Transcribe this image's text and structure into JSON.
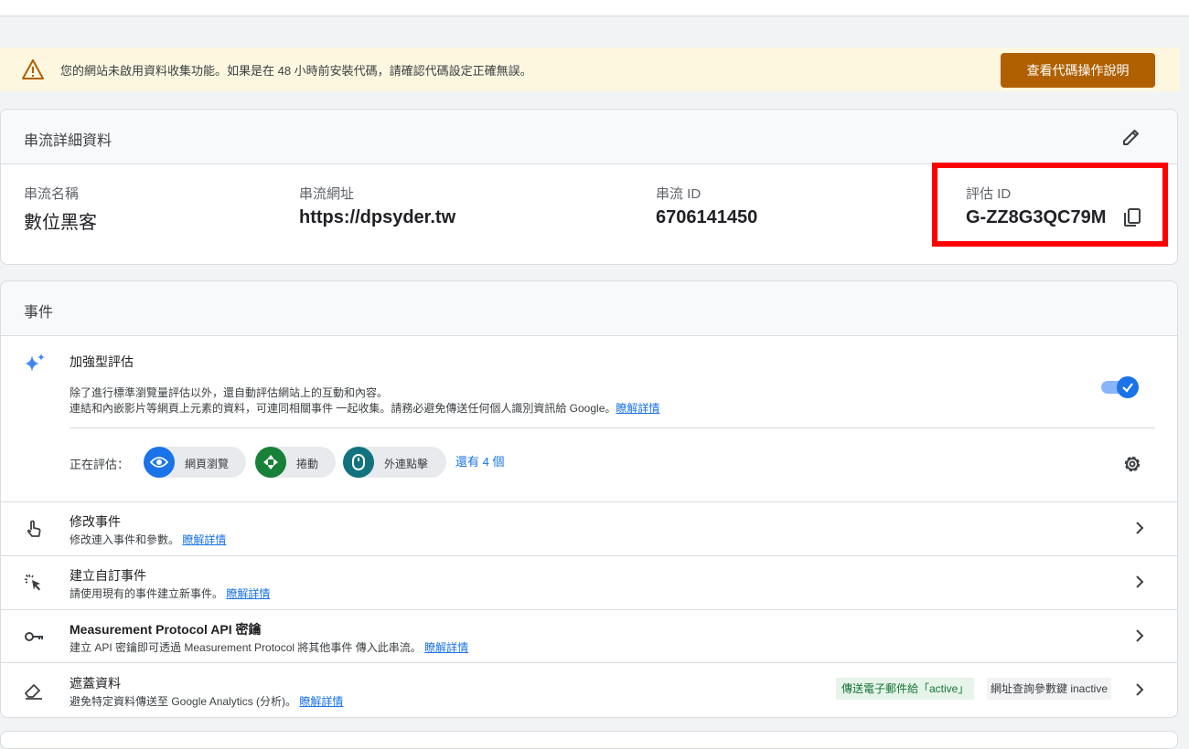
{
  "banner": {
    "message": "您的網站未啟用資料收集功能。如果是在 48 小時前安裝代碼，請確認代碼設定正確無誤。",
    "button_label": "查看代碼操作說明",
    "icon": "warning-icon",
    "color": "#b06000"
  },
  "stream_details": {
    "title": "串流詳細資料",
    "fields": [
      {
        "label": "串流名稱",
        "value": "數位黑客"
      },
      {
        "label": "串流網址",
        "value": "https://dpsyder.tw"
      },
      {
        "label": "串流 ID",
        "value": "6706141450"
      },
      {
        "label": "評估 ID",
        "value": "G-ZZ8G3QC79M"
      }
    ]
  },
  "events": {
    "title": "事件",
    "enhanced": {
      "title": "加強型評估",
      "desc_line1": "除了進行標準瀏覽量評估以外，還自動評估網站上的互動和內容。",
      "desc_line2": "連結和內嵌影片等網頁上元素的資料，可連同相關事件 一起收集。請務必避免傳送任何個人識別資訊給 Google。",
      "learn_more": "瞭解詳情",
      "toggle_on": true,
      "measuring_label": "正在評估：",
      "chips": [
        {
          "label": "網頁瀏覽",
          "icon": "eye-icon",
          "color": "#1a73e8"
        },
        {
          "label": "捲動",
          "icon": "scroll-arrows-icon",
          "color": "#188038"
        },
        {
          "label": "外連點擊",
          "icon": "mouse-icon",
          "color": "#12737e"
        }
      ],
      "more_label": "還有 4 個"
    },
    "rows": [
      {
        "title": "修改事件",
        "desc": "修改連入事件和參數。",
        "learn_more": "瞭解詳情",
        "icon": "touch-icon"
      },
      {
        "title": "建立自訂事件",
        "desc": "請使用現有的事件建立新事件。",
        "learn_more": "瞭解詳情",
        "icon": "click-icon"
      },
      {
        "title": "Measurement Protocol API 密鑰",
        "desc": "建立 API 密鑰即可透過 Measurement Protocol 將其他事件 傳入此串流。",
        "learn_more": "瞭解詳情",
        "icon": "key-icon"
      },
      {
        "title": "遮蓋資料",
        "desc": "避免特定資料傳送至 Google Analytics (分析)。",
        "learn_more": "瞭解詳情",
        "icon": "eraser-icon",
        "tag_active": "傳送電子郵件給「active」",
        "tag_inactive": "網址查詢參數鍵 inactive"
      }
    ]
  }
}
